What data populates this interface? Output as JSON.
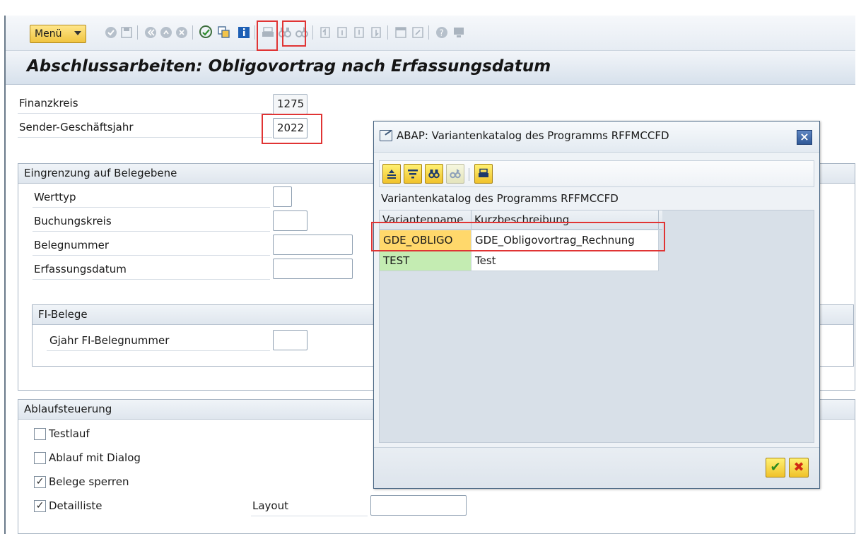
{
  "toolbar": {
    "menu_label": "Menü",
    "icons": [
      "enter-icon",
      "save-icon",
      "back-icon",
      "exit-icon",
      "cancel-icon",
      "execute-icon",
      "get-variant-icon",
      "info-icon",
      "print-icon",
      "find-icon",
      "find-next-icon",
      "first-page-icon",
      "previous-page-icon",
      "next-page-icon",
      "last-page-icon",
      "new-session-icon",
      "shortcut-icon",
      "help-icon",
      "layout-icon"
    ]
  },
  "page": {
    "title": "Abschlussarbeiten: Obligovortrag nach Erfassungsdatum"
  },
  "header_fields": {
    "finanzkreis_label": "Finanzkreis",
    "finanzkreis_value": "1275",
    "geschaeftsjahr_label": "Sender-Geschäftsjahr",
    "geschaeftsjahr_value": "2022"
  },
  "beleg_group": {
    "title": "Eingrenzung auf Belegebene",
    "werttyp_label": "Werttyp",
    "buchungskreis_label": "Buchungskreis",
    "belegnummer_label": "Belegnummer",
    "erfassungsdatum_label": "Erfassungsdatum",
    "fi_group": {
      "title": "FI-Belege",
      "gjahr_label": "Gjahr FI-Belegnummer"
    }
  },
  "ablauf_group": {
    "title": "Ablaufsteuerung",
    "testlauf_label": "Testlauf",
    "testlauf_checked": "",
    "dialog_label": "Ablauf mit Dialog",
    "dialog_checked": "",
    "sperren_label": "Belege sperren",
    "sperren_checked": "✓",
    "detailliste_label": "Detailliste",
    "detailliste_checked": "✓",
    "layout_label": "Layout"
  },
  "dialog": {
    "title": "ABAP: Variantenkatalog des Programms RFFMCCFD",
    "close_glyph": "×",
    "toolbar_icons": [
      "sort-ascending-icon",
      "filter-icon",
      "find-icon",
      "find-next-icon",
      "print-icon"
    ],
    "heading": "Variantenkatalog des Programms RFFMCCFD",
    "columns": [
      "Variantenname",
      "Kurzbeschreibung"
    ],
    "rows": [
      {
        "name": "GDE_OBLIGO",
        "description": "GDE_Obligovortrag_Rechnung",
        "selected": true
      },
      {
        "name": "TEST",
        "description": "Test",
        "selected": false
      }
    ],
    "ok_glyph": "✔",
    "cancel_glyph": "✖"
  },
  "colors": {
    "highlight": "#e03434",
    "selected_row": "#ffd86b",
    "normal_key": "#c4ecb2"
  }
}
